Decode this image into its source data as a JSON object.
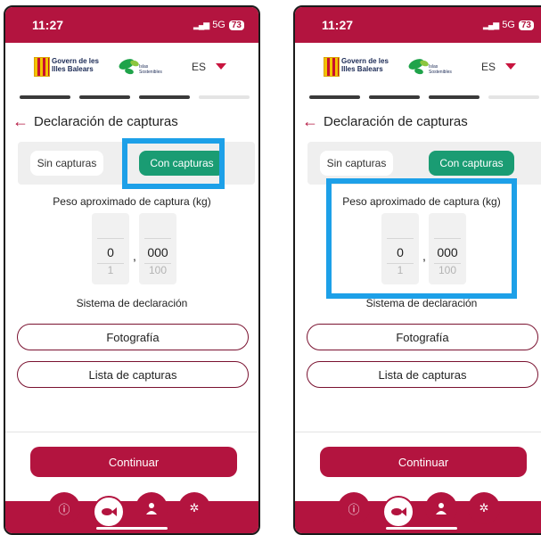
{
  "status_bar": {
    "time": "11:27",
    "network": "5G",
    "battery": "73"
  },
  "header": {
    "govern_logo_text": [
      "Govern de les",
      "Illes Balears"
    ],
    "islas_logo_text": [
      "Islas",
      "Sostenibles"
    ],
    "language": "ES"
  },
  "progress": {
    "total_steps": 4,
    "completed_steps": 3
  },
  "page": {
    "title": "Declaración de capturas"
  },
  "segment": {
    "sin_label": "Sin capturas",
    "con_label": "Con capturas",
    "selected": "Con capturas"
  },
  "weight": {
    "label": "Peso aproximado de captura (kg)",
    "integer_value": "0",
    "integer_next": "1",
    "separator": ",",
    "decimal_value": "000",
    "decimal_next": "100"
  },
  "sistema": {
    "label": "Sistema de declaración",
    "foto_label": "Fotografía",
    "lista_label": "Lista de capturas"
  },
  "footer": {
    "continue_label": "Continuar"
  },
  "tabbar": {
    "active_tab": "fish"
  },
  "colors": {
    "primary": "#b3143f",
    "selected_green": "#1a9c73",
    "highlight": "#1da0e8"
  }
}
